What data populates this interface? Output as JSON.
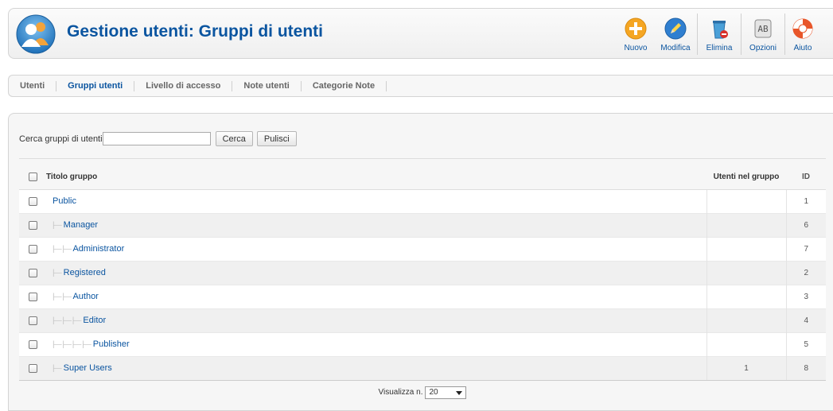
{
  "header": {
    "title": "Gestione utenti: Gruppi di utenti",
    "logo_icon": "users-icon"
  },
  "toolbar": [
    {
      "name": "new-button",
      "label": "Nuovo",
      "icon": "plus-circle-icon",
      "color": "#f5a623"
    },
    {
      "name": "edit-button",
      "label": "Modifica",
      "icon": "pencil-icon",
      "color": "#2f7fd0"
    },
    {
      "name": "delete-button",
      "label": "Elimina",
      "icon": "trash-icon",
      "color": "#3a8fc8"
    },
    {
      "name": "options-button",
      "label": "Opzioni",
      "icon": "options-icon",
      "color": "#9a9a9a"
    },
    {
      "name": "help-button",
      "label": "Aiuto",
      "icon": "lifebuoy-icon",
      "color": "#e8562a"
    }
  ],
  "submenu": [
    {
      "label": "Utenti",
      "active": false
    },
    {
      "label": "Gruppi utenti",
      "active": true
    },
    {
      "label": "Livello di accesso",
      "active": false
    },
    {
      "label": "Note utenti",
      "active": false
    },
    {
      "label": "Categorie Note",
      "active": false
    }
  ],
  "filter": {
    "label": "Cerca gruppi di utenti",
    "value": "",
    "search_button": "Cerca",
    "clear_button": "Pulisci"
  },
  "table": {
    "headers": {
      "title": "Titolo gruppo",
      "users": "Utenti nel gruppo",
      "id": "ID"
    },
    "rows": [
      {
        "indent": "",
        "title": "Public",
        "users": "",
        "id": "1"
      },
      {
        "indent": "|—",
        "title": "Manager",
        "users": "",
        "id": "6"
      },
      {
        "indent": "|— |—",
        "title": "Administrator",
        "users": "",
        "id": "7"
      },
      {
        "indent": "|—",
        "title": "Registered",
        "users": "",
        "id": "2"
      },
      {
        "indent": "|— |—",
        "title": "Author",
        "users": "",
        "id": "3"
      },
      {
        "indent": "|— |— |—",
        "title": "Editor",
        "users": "",
        "id": "4"
      },
      {
        "indent": "|— |— |— |—",
        "title": "Publisher",
        "users": "",
        "id": "5"
      },
      {
        "indent": "|—",
        "title": "Super Users",
        "users": "1",
        "id": "8"
      }
    ]
  },
  "footer": {
    "limit_label": "Visualizza n.",
    "limit_value": "20"
  }
}
